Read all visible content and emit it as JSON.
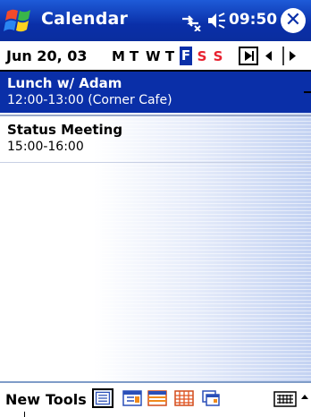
{
  "titlebar": {
    "app_title": "Calendar",
    "clock": "09:50",
    "icons": {
      "start": "windows-flag-icon",
      "connectivity": "connectivity-icon",
      "volume": "volume-icon",
      "close": "close-icon"
    },
    "close_glyph": "✕"
  },
  "datebar": {
    "date": "Jun 20, 03",
    "weekdays": [
      "M",
      "T",
      "W",
      "T",
      "F",
      "S",
      "S"
    ],
    "selected_day_index": 4,
    "icons": {
      "today": "goto-today-icon",
      "prev": "previous-icon",
      "next": "next-icon"
    }
  },
  "agenda": {
    "appointments": [
      {
        "title": "Lunch w/ Adam",
        "time": "12:00-13:00 (Corner Cafe)",
        "selected": true
      },
      {
        "title": "Status Meeting",
        "time": "15:00-16:00",
        "selected": false
      }
    ]
  },
  "commandbar": {
    "menu_new": "New",
    "menu_tools": "Tools",
    "views": [
      "agenda-view-icon",
      "day-view-icon",
      "week-view-icon",
      "month-view-icon",
      "year-view-icon"
    ],
    "icons": {
      "keyboard": "keyboard-icon",
      "sip": "input-panel-arrow-icon"
    }
  },
  "colors": {
    "titlebar_blue": "#0a2fa8",
    "selection_blue": "#0a2fa8",
    "weekend_red": "#e8212f"
  }
}
